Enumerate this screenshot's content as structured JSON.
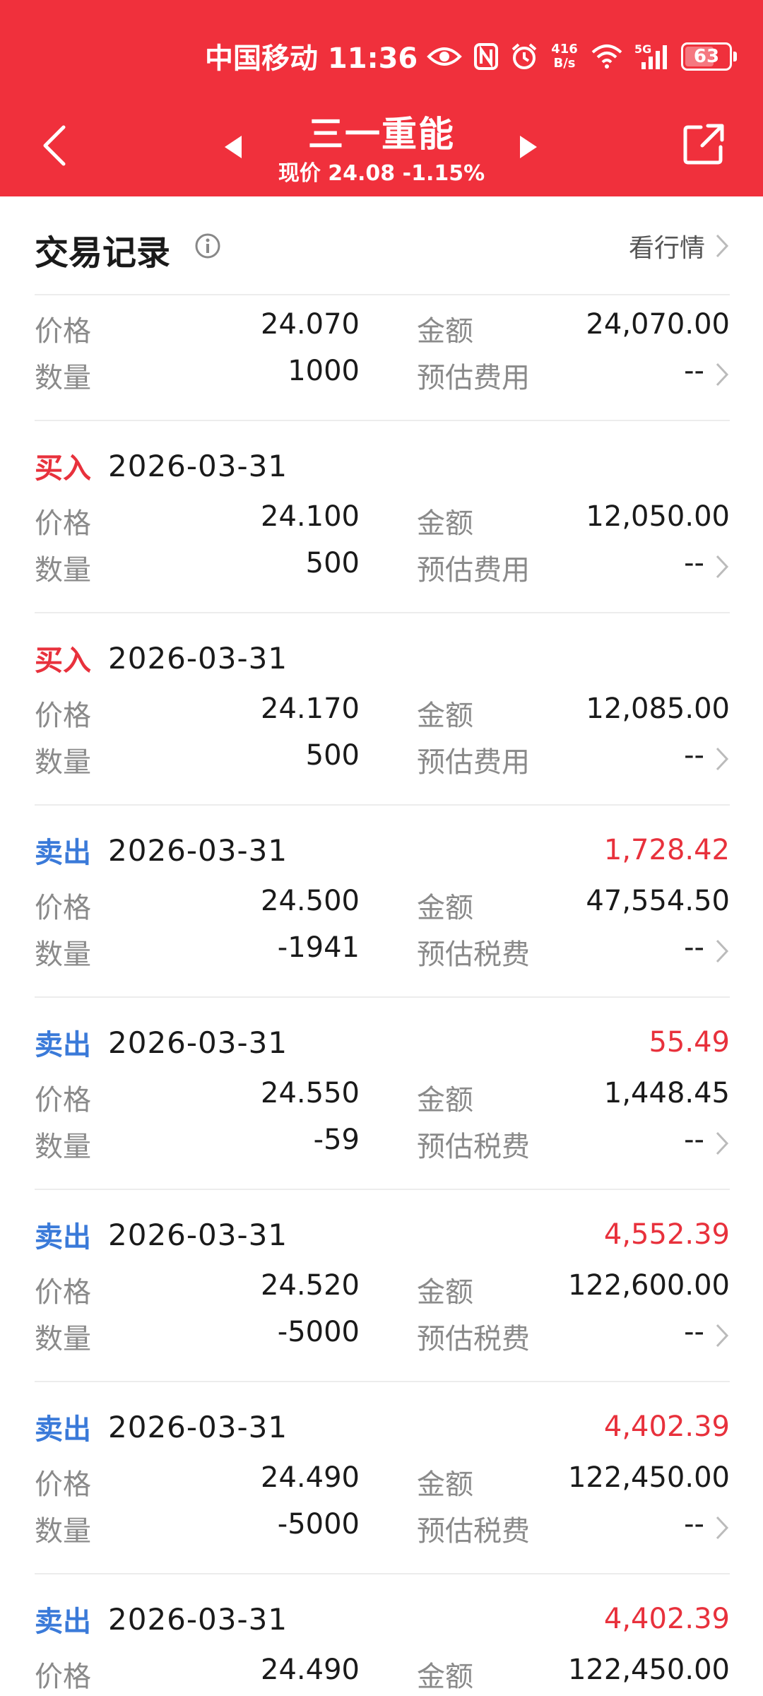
{
  "status_bar": {
    "carrier_time": "中国移动 11:36",
    "net_speed_value": "416",
    "net_speed_unit": "B/s",
    "signal_label": "5G",
    "battery": "63"
  },
  "nav": {
    "title": "三一重能",
    "subtitle": "现价 24.08 -1.15%"
  },
  "section": {
    "title": "交易记录",
    "market_link": "看行情"
  },
  "labels": {
    "price": "价格",
    "amount": "金额",
    "quantity": "数量",
    "est_fee": "预估费用",
    "est_tax_fee": "预估税费"
  },
  "records": [
    {
      "side": "",
      "date": "",
      "pnl": "",
      "price": "24.070",
      "amount": "24,070.00",
      "qty": "1000",
      "fee_label": "预估费用",
      "fee": "--"
    },
    {
      "side": "买入",
      "date": "2026-03-31",
      "pnl": "",
      "price": "24.100",
      "amount": "12,050.00",
      "qty": "500",
      "fee_label": "预估费用",
      "fee": "--"
    },
    {
      "side": "买入",
      "date": "2026-03-31",
      "pnl": "",
      "price": "24.170",
      "amount": "12,085.00",
      "qty": "500",
      "fee_label": "预估费用",
      "fee": "--"
    },
    {
      "side": "卖出",
      "date": "2026-03-31",
      "pnl": "1,728.42",
      "price": "24.500",
      "amount": "47,554.50",
      "qty": "-1941",
      "fee_label": "预估税费",
      "fee": "--"
    },
    {
      "side": "卖出",
      "date": "2026-03-31",
      "pnl": "55.49",
      "price": "24.550",
      "amount": "1,448.45",
      "qty": "-59",
      "fee_label": "预估税费",
      "fee": "--"
    },
    {
      "side": "卖出",
      "date": "2026-03-31",
      "pnl": "4,552.39",
      "price": "24.520",
      "amount": "122,600.00",
      "qty": "-5000",
      "fee_label": "预估税费",
      "fee": "--"
    },
    {
      "side": "卖出",
      "date": "2026-03-31",
      "pnl": "4,402.39",
      "price": "24.490",
      "amount": "122,450.00",
      "qty": "-5000",
      "fee_label": "预估税费",
      "fee": "--"
    },
    {
      "side": "卖出",
      "date": "2026-03-31",
      "pnl": "4,402.39",
      "price": "24.490",
      "amount": "122,450.00",
      "qty": "",
      "fee_label": "",
      "fee": ""
    }
  ],
  "colors": {
    "header_red": "#f0303c",
    "buy_red": "#e8313c",
    "sell_blue": "#3a7ad9"
  }
}
